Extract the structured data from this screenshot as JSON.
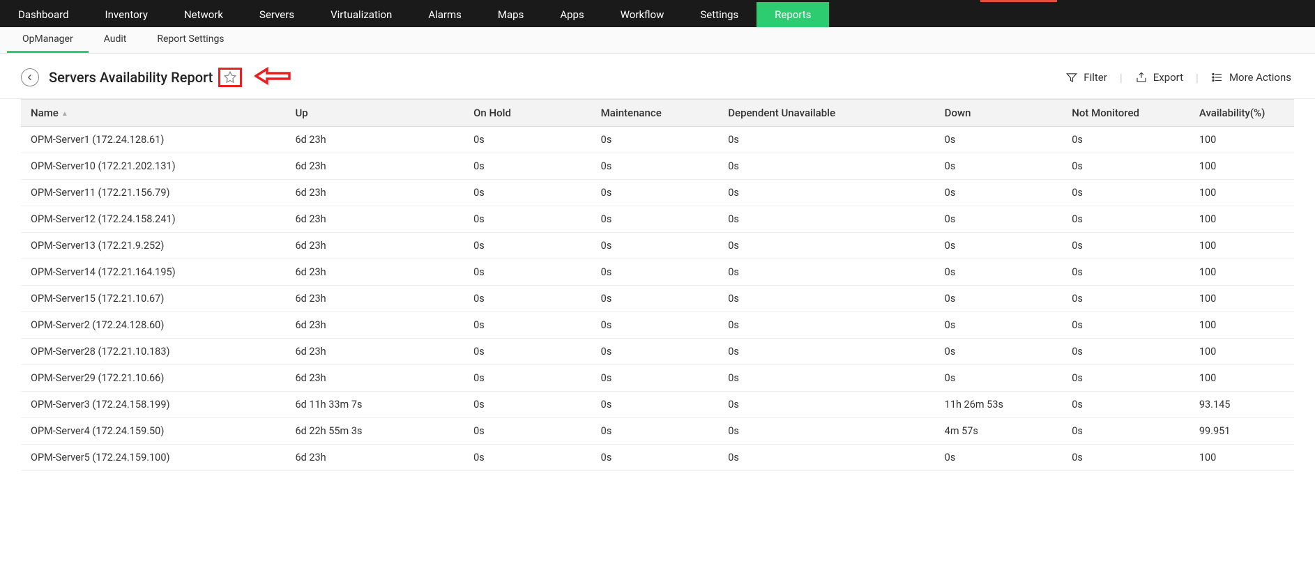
{
  "main_nav": {
    "items": [
      {
        "label": "Dashboard",
        "active": false
      },
      {
        "label": "Inventory",
        "active": false
      },
      {
        "label": "Network",
        "active": false
      },
      {
        "label": "Servers",
        "active": false
      },
      {
        "label": "Virtualization",
        "active": false
      },
      {
        "label": "Alarms",
        "active": false
      },
      {
        "label": "Maps",
        "active": false
      },
      {
        "label": "Apps",
        "active": false
      },
      {
        "label": "Workflow",
        "active": false
      },
      {
        "label": "Settings",
        "active": false
      },
      {
        "label": "Reports",
        "active": true
      }
    ]
  },
  "sub_nav": {
    "items": [
      {
        "label": "OpManager",
        "active": true
      },
      {
        "label": "Audit",
        "active": false
      },
      {
        "label": "Report Settings",
        "active": false
      }
    ]
  },
  "page": {
    "title": "Servers Availability Report"
  },
  "actions": {
    "filter": "Filter",
    "export": "Export",
    "more": "More Actions"
  },
  "table": {
    "columns": [
      "Name",
      "Up",
      "On Hold",
      "Maintenance",
      "Dependent Unavailable",
      "Down",
      "Not Monitored",
      "Availability(%)"
    ],
    "sort_column": 0,
    "rows": [
      {
        "name": "OPM-Server1 (172.24.128.61)",
        "up": "6d 23h",
        "onhold": "0s",
        "maint": "0s",
        "dep": "0s",
        "down": "0s",
        "notmon": "0s",
        "avail": "100"
      },
      {
        "name": "OPM-Server10 (172.21.202.131)",
        "up": "6d 23h",
        "onhold": "0s",
        "maint": "0s",
        "dep": "0s",
        "down": "0s",
        "notmon": "0s",
        "avail": "100"
      },
      {
        "name": "OPM-Server11 (172.21.156.79)",
        "up": "6d 23h",
        "onhold": "0s",
        "maint": "0s",
        "dep": "0s",
        "down": "0s",
        "notmon": "0s",
        "avail": "100"
      },
      {
        "name": "OPM-Server12 (172.24.158.241)",
        "up": "6d 23h",
        "onhold": "0s",
        "maint": "0s",
        "dep": "0s",
        "down": "0s",
        "notmon": "0s",
        "avail": "100"
      },
      {
        "name": "OPM-Server13 (172.21.9.252)",
        "up": "6d 23h",
        "onhold": "0s",
        "maint": "0s",
        "dep": "0s",
        "down": "0s",
        "notmon": "0s",
        "avail": "100"
      },
      {
        "name": "OPM-Server14 (172.21.164.195)",
        "up": "6d 23h",
        "onhold": "0s",
        "maint": "0s",
        "dep": "0s",
        "down": "0s",
        "notmon": "0s",
        "avail": "100"
      },
      {
        "name": "OPM-Server15 (172.21.10.67)",
        "up": "6d 23h",
        "onhold": "0s",
        "maint": "0s",
        "dep": "0s",
        "down": "0s",
        "notmon": "0s",
        "avail": "100"
      },
      {
        "name": "OPM-Server2 (172.24.128.60)",
        "up": "6d 23h",
        "onhold": "0s",
        "maint": "0s",
        "dep": "0s",
        "down": "0s",
        "notmon": "0s",
        "avail": "100"
      },
      {
        "name": "OPM-Server28 (172.21.10.183)",
        "up": "6d 23h",
        "onhold": "0s",
        "maint": "0s",
        "dep": "0s",
        "down": "0s",
        "notmon": "0s",
        "avail": "100"
      },
      {
        "name": "OPM-Server29 (172.21.10.66)",
        "up": "6d 23h",
        "onhold": "0s",
        "maint": "0s",
        "dep": "0s",
        "down": "0s",
        "notmon": "0s",
        "avail": "100"
      },
      {
        "name": "OPM-Server3 (172.24.158.199)",
        "up": "6d 11h 33m 7s",
        "onhold": "0s",
        "maint": "0s",
        "dep": "0s",
        "down": "11h 26m 53s",
        "notmon": "0s",
        "avail": "93.145"
      },
      {
        "name": "OPM-Server4 (172.24.159.50)",
        "up": "6d 22h 55m 3s",
        "onhold": "0s",
        "maint": "0s",
        "dep": "0s",
        "down": "4m 57s",
        "notmon": "0s",
        "avail": "99.951"
      },
      {
        "name": "OPM-Server5 (172.24.159.100)",
        "up": "6d 23h",
        "onhold": "0s",
        "maint": "0s",
        "dep": "0s",
        "down": "0s",
        "notmon": "0s",
        "avail": "100"
      }
    ]
  }
}
